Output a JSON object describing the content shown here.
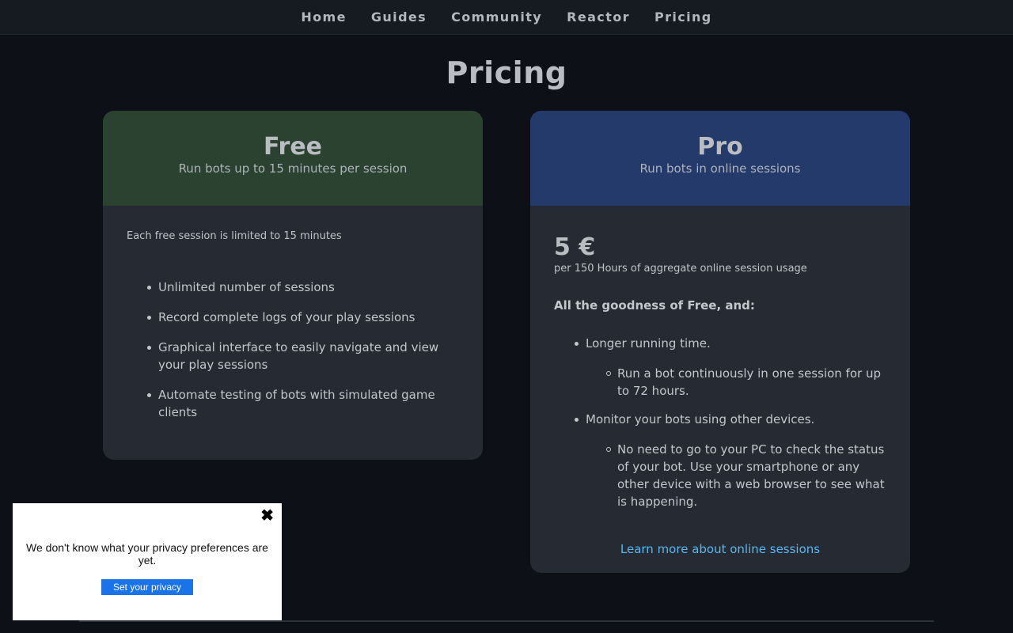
{
  "nav": {
    "items": [
      {
        "label": "Home"
      },
      {
        "label": "Guides"
      },
      {
        "label": "Community"
      },
      {
        "label": "Reactor"
      },
      {
        "label": "Pricing"
      }
    ]
  },
  "page": {
    "title": "Pricing"
  },
  "free": {
    "name": "Free",
    "subtitle": "Run bots up to 15 minutes per session",
    "note": "Each free session is limited to 15 minutes",
    "features": [
      "Unlimited number of sessions",
      "Record complete logs of your play sessions",
      "Graphical interface to easily navigate and view your play sessions",
      "Automate testing of bots with simulated game clients"
    ]
  },
  "pro": {
    "name": "Pro",
    "subtitle": "Run bots in online sessions",
    "price": "5 €",
    "price_note": "per 150 Hours of aggregate online session usage",
    "intro": "All the goodness of Free, and:",
    "features": [
      {
        "label": "Longer running time.",
        "detail": "Run a bot continuously in one session for up to 72 hours."
      },
      {
        "label": "Monitor your bots using other devices.",
        "detail": "No need to go to your PC to check the status of your bot. Use your smartphone or any other device with a web browser to see what is happening."
      }
    ],
    "link": "Learn more about online sessions"
  },
  "privacy": {
    "close_icon": "close-icon",
    "message": "We don't know what your privacy preferences are yet.",
    "button": "Set your privacy"
  },
  "colors": {
    "background": "#0d1117",
    "free_header": "#2b4231",
    "pro_header": "#233a6b",
    "card_body": "#262a33",
    "link": "#58b8ef",
    "privacy_button": "#1a73e8"
  }
}
